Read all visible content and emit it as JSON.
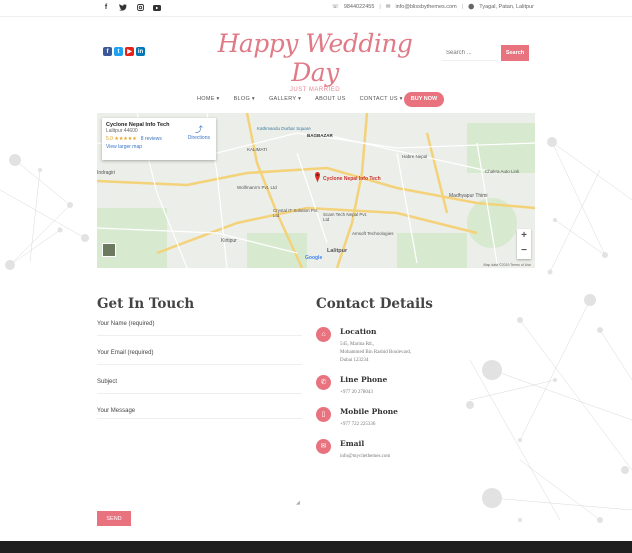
{
  "topbar": {
    "phone": "9844022455",
    "email": "info@blissbythemes.com",
    "address": "Tyagal, Patan, Lalitpur"
  },
  "header": {
    "logo_title": "Happy Wedding Day",
    "logo_subtitle": "JUST MARRIED",
    "search_placeholder": "Search ...",
    "search_button": "Search"
  },
  "nav": {
    "items": [
      "HOME",
      "BLOG",
      "GALLERY",
      "ABOUT US",
      "CONTACT US"
    ],
    "buy_now": "BUY NOW"
  },
  "map": {
    "place_name": "Cyclone Nepal Info Tech",
    "place_address": "Lalitpur 44600",
    "rating": "5.0",
    "stars": "★★★★★",
    "reviews": "8 reviews",
    "larger_map": "View larger map",
    "directions": "Directions",
    "pin_label": "Cyclone Nepal Info Tech",
    "footer": "Map data ©2019   Terms of Use",
    "labels": [
      "BAGBAZAR",
      "Kathmandu Durbar Square",
      "KALIMATI",
      "Indragiri",
      "Wolfmann's Pvt. Ltd",
      "Crystal IT Solution Pvt. Ltd",
      "Scam Tech Nepal Pvt. Ltd",
      "Amsoft Technologies",
      "Habre Nepal",
      "Chakra Auto Link",
      "Madhyapur Thimi",
      "Kirtipur",
      "Lalitpur",
      "Google"
    ],
    "zoom_in": "+",
    "zoom_out": "−"
  },
  "form": {
    "title": "Get In Touch",
    "name_label": "Your Name (required)",
    "email_label": "Your Email (required)",
    "subject_label": "Subject",
    "message_label": "Your Message",
    "send_button": "SEND"
  },
  "contact": {
    "title": "Contact Details",
    "location_title": "Location",
    "location_lines": [
      "545, Marina Rd.,",
      "Mohammed Bin Rashid Boulevard,",
      "Dubai 123234"
    ],
    "phone_title": "Line Phone",
    "phone_value": "+977 20 278043",
    "mobile_title": "Mobile Phone",
    "mobile_value": "+977 722 225336",
    "email_title": "Email",
    "email_value": "info@mycitethemes.com"
  },
  "colors": {
    "accent": "#e8727e",
    "footer": "#1f1f1f"
  }
}
